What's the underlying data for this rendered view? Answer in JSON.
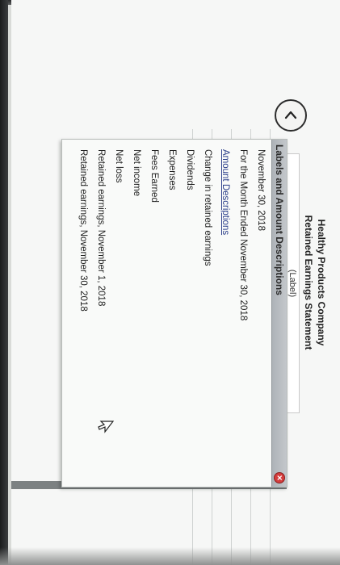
{
  "statement": {
    "company": "Healthy Products Company",
    "title": "Retained Earnings Statement",
    "label_placeholder": "(Label)"
  },
  "popup": {
    "title": "Labels and Amount Descriptions",
    "close_icon": "close-icon",
    "items": [
      {
        "text": "November 30, 2018",
        "section": false
      },
      {
        "text": "For the Month Ended November 30, 2018",
        "section": false
      },
      {
        "text": "Amount Descriptions",
        "section": true
      },
      {
        "text": "Change in retained earnings",
        "section": false
      },
      {
        "text": "Dividends",
        "section": false
      },
      {
        "text": "Expenses",
        "section": false
      },
      {
        "text": "Fees Earned",
        "section": false
      },
      {
        "text": "Net income",
        "section": false
      },
      {
        "text": "Net loss",
        "section": false
      },
      {
        "text": "Retained earnings, November 1, 2018",
        "section": false
      },
      {
        "text": "Retained earnings, November 30, 2018",
        "section": false
      }
    ]
  },
  "controls": {
    "back_icon": "chevron-up-icon",
    "cursor_icon": "mouse-pointer-icon"
  },
  "colors": {
    "close": "#d43c3c",
    "section_link": "#2b3e8a"
  }
}
